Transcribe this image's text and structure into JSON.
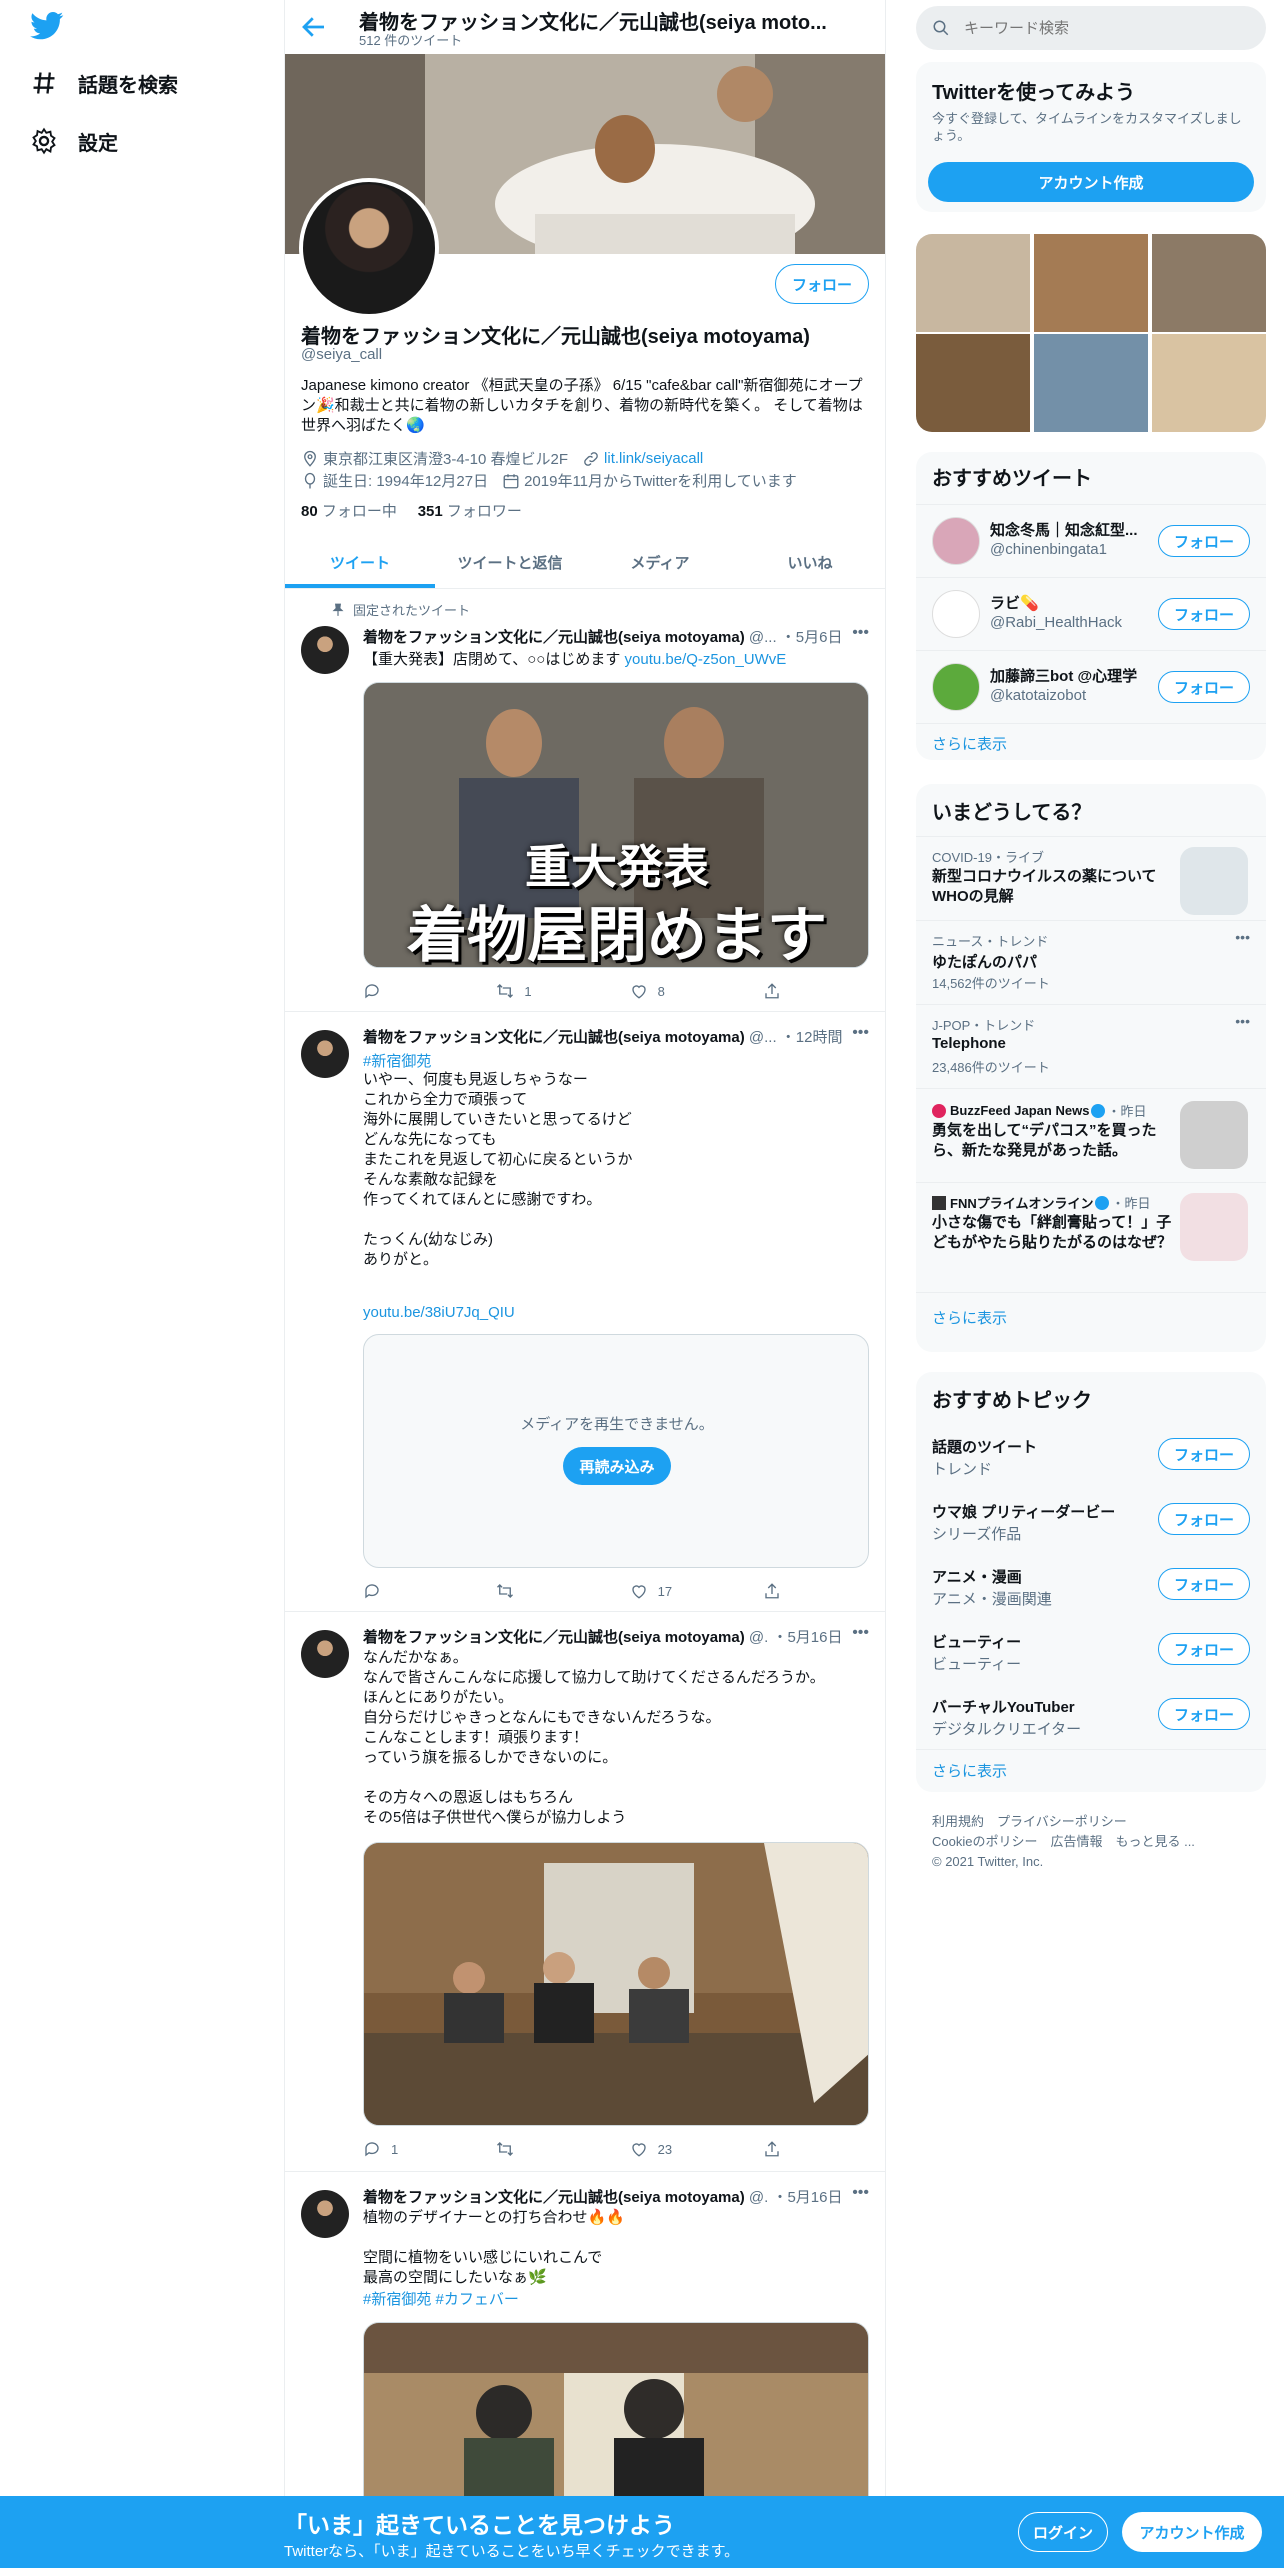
{
  "nav": {
    "explore": "話題を検索",
    "settings": "設定"
  },
  "header": {
    "title": "着物をファッション文化に／元山誠也(seiya moto...",
    "tweet_count": "512 件のツイート"
  },
  "profile": {
    "follow": "フォロー",
    "name": "着物をファッション文化に／元山誠也(seiya motoyama)",
    "handle": "@seiya_call",
    "bio": "Japanese kimono creator 《桓武天皇の子孫》 6/15 \"cafe&bar call\"新宿御苑にオープン🎉和裁士と共に着物の新しいカタチを創り、着物の新時代を築く。 そして着物は世界へ羽ばたく🌏",
    "location": "東京都江東区清澄3-4-10 春煌ビル2F",
    "link": "lit.link/seiyacall",
    "birthday": "誕生日: 1994年12月27日",
    "joined": "2019年11月からTwitterを利用しています",
    "following_count": "80",
    "following_label": "フォロー中",
    "followers_count": "351",
    "followers_label": "フォロワー"
  },
  "tabs": [
    "ツイート",
    "ツイートと返信",
    "メディア",
    "いいね"
  ],
  "tweets": [
    {
      "pinned_label": "固定されたツイート",
      "author": "着物をファッション文化に／元山誠也(seiya motoyama)",
      "handle": "@...",
      "time": "・5月6日",
      "text": "【重大発表】店閉めて、○○はじめます ",
      "link": "youtu.be/Q-z5on_UWvE",
      "thumb_line1": "重大発表",
      "thumb_line2": "着物屋閉めます",
      "retweets": "1",
      "likes": "8"
    },
    {
      "author": "着物をファッション文化に／元山誠也(seiya motoyama)",
      "handle": "@...",
      "time": "・12時間",
      "hashtag": "#新宿御苑",
      "text": "いやー、何度も見返しちゃうなー\nこれから全力で頑張って\n海外に展開していきたいと思ってるけど\nどんな先になっても\nまたこれを見返して初心に戻るというか\nそんな素敵な記録を\n作ってくれてほんとに感謝ですわ。\n\nたっくん(幼なじみ)\nありがと。",
      "link": "youtu.be/38iU7Jq_QIU",
      "media_error": "メディアを再生できません。",
      "reload": "再読み込み",
      "likes": "17"
    },
    {
      "author": "着物をファッション文化に／元山誠也(seiya motoyama)",
      "handle": "@.",
      "time": "・5月16日",
      "text": "なんだかなぁ。\nなんで皆さんこんなに応援して協力して助けてくださるんだろうか。\nほんとにありがたい。\n自分らだけじゃきっとなんにもできないんだろうな。\nこんなことします！頑張ります！\nっていう旗を振るしかできないのに。\n\nその方々への恩返しはもちろん\nその5倍は子供世代へ僕らが協力しよう",
      "replies": "1",
      "likes": "23"
    },
    {
      "author": "着物をファッション文化に／元山誠也(seiya motoyama)",
      "handle": "@.",
      "time": "・5月16日",
      "text": "植物のデザイナーとの打ち合わせ🔥🔥\n\n空間に植物をいい感じにいれこんで\n最高の空間にしたいなぁ🌿",
      "hashtags": "#新宿御苑 #カフェバー"
    }
  ],
  "right": {
    "search_placeholder": "キーワード検索",
    "signup_title": "Twitterを使ってみよう",
    "signup_sub": "今すぐ登録して、タイムラインをカスタマイズしましょう。",
    "signup_btn": "アカウント作成",
    "rec_tweets_title": "おすすめツイート",
    "rec_users": [
      {
        "name": "知念冬馬｜知念紅型...",
        "handle": "@chinenbingata1",
        "color": "#d9a6b8"
      },
      {
        "name": "ラビ💊",
        "handle": "@Rabi_HealthHack",
        "color": "#ffffff"
      },
      {
        "name": "加藤諦三bot @心理学",
        "handle": "@katotaizobot",
        "color": "#5caa3c"
      }
    ],
    "follow": "フォロー",
    "show_more": "さらに表示",
    "trends_title": "いまどうしてる？",
    "trends": [
      {
        "meta": "COVID-19・ライブ",
        "title": "新型コロナウイルスの薬について WHOの見解"
      },
      {
        "meta": "ニュース・トレンド",
        "title": "ゆたぽんのパパ",
        "count": "14,562件のツイート"
      },
      {
        "meta": "J-POP・トレンド",
        "title": "Telephone",
        "count": "23,486件のツイート"
      },
      {
        "meta": "BuzzFeed Japan News",
        "time": "・昨日",
        "title": "勇気を出して“デパコス”を買ったら、新たな発見があった話。"
      },
      {
        "meta": "FNNプライムオンライン",
        "time": "・昨日",
        "title": "小さな傷でも「絆創膏貼って！」子どもがやたら貼りたがるのはなぜ？"
      }
    ],
    "topics_title": "おすすめトピック",
    "topics": [
      {
        "name": "話題のツイート",
        "cat": "トレンド"
      },
      {
        "name": "ウマ娘 プリティーダービー",
        "cat": "シリーズ作品"
      },
      {
        "name": "アニメ・漫画",
        "cat": "アニメ・漫画関連"
      },
      {
        "name": "ビューティー",
        "cat": "ビューティー"
      },
      {
        "name": "バーチャルYouTuber",
        "cat": "デジタルクリエイター"
      }
    ],
    "footer1": "利用規約　プライバシーポリシー",
    "footer2": "Cookieのポリシー　広告情報　もっと見る ...",
    "footer3": "© 2021 Twitter, Inc."
  },
  "bottom": {
    "title": "「いま」起きていることを見つけよう",
    "sub": "Twitterなら、「いま」起きていることをいち早くチェックできます。",
    "login": "ログイン",
    "signup": "アカウント作成"
  },
  "colors": {
    "accent": "#1da1f2",
    "link": "#1b95e0",
    "text_secondary": "#5b7083"
  }
}
